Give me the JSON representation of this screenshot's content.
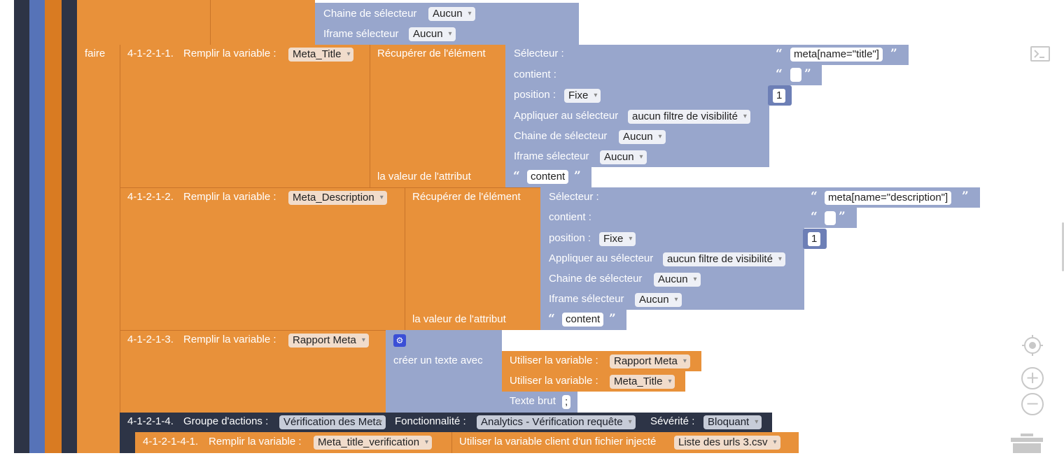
{
  "top_block": {
    "chaine_label": "Chaine de sélecteur",
    "chaine_value": "Aucun",
    "iframe_label": "Iframe sélecteur",
    "iframe_value": "Aucun"
  },
  "faire_label": "faire",
  "steps": [
    {
      "num": "4-1-2-1-1.",
      "remplir": "Remplir la variable :",
      "variable": "Meta_Title",
      "recuperer": "Récupérer de l'élément",
      "selecteur_label": "Sélecteur :",
      "selecteur_value": "meta[name=\"title\"]",
      "contient_label": "contient :",
      "position_label": "position :",
      "position_value": "Fixe",
      "position_num": "1",
      "appliquer_label": "Appliquer au sélecteur",
      "appliquer_value": "aucun filtre de visibilité",
      "chaine_label": "Chaine de sélecteur",
      "chaine_value": "Aucun",
      "iframe_label": "Iframe sélecteur",
      "iframe_value": "Aucun",
      "attribut_label": "la valeur de l'attribut",
      "attribut_value": "content"
    },
    {
      "num": "4-1-2-1-2.",
      "remplir": "Remplir la variable :",
      "variable": "Meta_Description",
      "recuperer": "Récupérer de l'élément",
      "selecteur_label": "Sélecteur :",
      "selecteur_value": "meta[name=\"description\"]",
      "contient_label": "contient :",
      "position_label": "position :",
      "position_value": "Fixe",
      "position_num": "1",
      "appliquer_label": "Appliquer au sélecteur",
      "appliquer_value": "aucun filtre de visibilité",
      "chaine_label": "Chaine de sélecteur",
      "chaine_value": "Aucun",
      "iframe_label": "Iframe sélecteur",
      "iframe_value": "Aucun",
      "attribut_label": "la valeur de l'attribut",
      "attribut_value": "content"
    }
  ],
  "step3": {
    "num": "4-1-2-1-3.",
    "remplir": "Remplir la variable :",
    "variable": "Rapport Meta",
    "creer": "créer un texte avec",
    "use1_label": "Utiliser la variable :",
    "use1_value": "Rapport Meta",
    "use2_label": "Utiliser la variable :",
    "use2_value": "Meta_Title",
    "brut_label": "Texte brut",
    "brut_value": ";"
  },
  "step4": {
    "num": "4-1-2-1-4.",
    "groupe_label": "Groupe d'actions :",
    "groupe_value": "Vérification des Meta",
    "fonc_label": "Fonctionnalité :",
    "fonc_value": "Analytics - Vérification requête",
    "sev_label": "Sévérité :",
    "sev_value": "Bloquant"
  },
  "step41": {
    "num": "4-1-2-1-4-1.",
    "remplir": "Remplir la variable :",
    "variable": "Meta_title_verification",
    "client_label": "Utiliser la variable client d'un fichier injecté",
    "client_value": "Liste des urls 3.csv"
  },
  "quote_open": "“",
  "quote_close": "”",
  "icons": [
    "console-icon",
    "gear-icon",
    "recenter-icon",
    "zoom-in-icon",
    "zoom-out-icon",
    "trash-icon"
  ],
  "colors": {
    "orange": "#e8913a",
    "blue": "#98a6cc",
    "dark": "#2d3446"
  }
}
